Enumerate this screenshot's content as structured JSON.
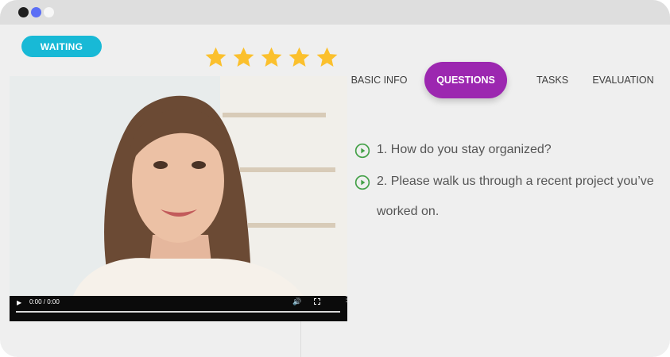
{
  "status": {
    "label": "WAITING",
    "color": "#18b9d6"
  },
  "rating": {
    "value": 5,
    "max": 5,
    "star_color": "#fbc02d"
  },
  "video": {
    "time": "0:00 / 0:00",
    "progress": 0
  },
  "tabs": [
    {
      "label": "BASIC INFO",
      "active": false
    },
    {
      "label": "QUESTIONS",
      "active": true
    },
    {
      "label": "TASKS",
      "active": false
    },
    {
      "label": "EVALUATION",
      "active": false
    }
  ],
  "questions": [
    {
      "text": "1. How do you stay organized?"
    },
    {
      "text": "2. Please walk us through a recent project you’ve worked on."
    }
  ],
  "colors": {
    "accent": "#9c27b0",
    "play_icon": "#43a047",
    "status": "#18b9d6"
  },
  "icons": {
    "window_dots": [
      "close-dot",
      "minimize-dot",
      "maximize-dot"
    ],
    "question_play": "play-circle-icon",
    "video_controls": [
      "play-icon",
      "volume-icon",
      "fullscreen-icon",
      "more-vert-icon"
    ]
  }
}
